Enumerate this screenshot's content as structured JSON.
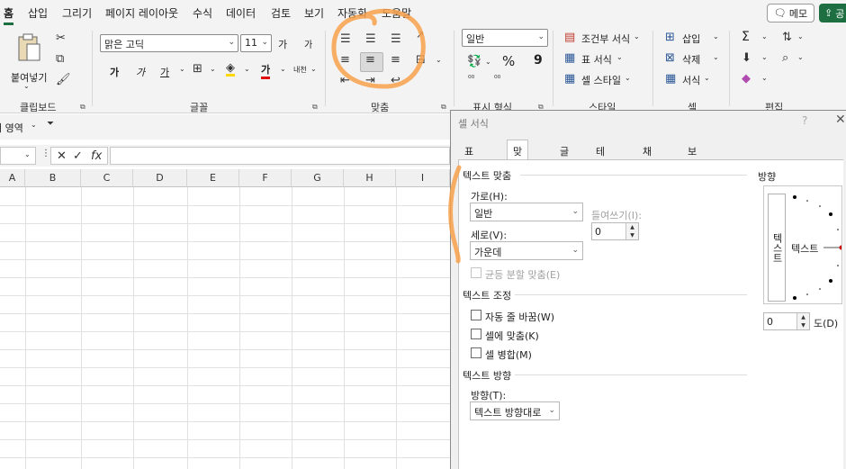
{
  "menubar": {
    "tabs": [
      "홈",
      "삽입",
      "그리기",
      "페이지 레이아웃",
      "수식",
      "데이터",
      "검토",
      "보기",
      "자동화",
      "도움말"
    ],
    "memo_label": "메모",
    "share_label": "공"
  },
  "ribbon": {
    "clipboard": {
      "paste_label": "붙여넣기",
      "group_label": "클립보드"
    },
    "font": {
      "font_name": "맑은 고딕",
      "font_size": "11",
      "bold": "가",
      "italic": "가",
      "underline": "가",
      "font_color_glyph": "가",
      "grow": "가",
      "shrink": "가",
      "phonetic": "내천",
      "group_label": "글꼴"
    },
    "alignment": {
      "group_label": "맞춤"
    },
    "number": {
      "format": "일반",
      "percent": "%",
      "comma": "9",
      "group_label": "표시 형식"
    },
    "styles": {
      "conditional": "조건부 서식",
      "table": "표 서식",
      "cell_style": "셀 스타일",
      "group_label": "스타일"
    },
    "cells": {
      "insert": "삽입",
      "delete": "삭제",
      "format": "서식",
      "group_label": "셀"
    },
    "editing": {
      "sum": "Σ",
      "group_label": "편집"
    }
  },
  "qa": {
    "area_label": "내 영역"
  },
  "grid": {
    "columns": [
      "A",
      "B",
      "C",
      "D",
      "E",
      "F",
      "G",
      "H",
      "I"
    ]
  },
  "dialog": {
    "title": "셀 서식",
    "help": "?",
    "close": "✕",
    "tabs": [
      "표시 형식",
      "맞춤",
      "글꼴",
      "테두리",
      "채우기",
      "보호"
    ],
    "active_tab": "맞춤",
    "text_align_section": "텍스트 맞춤",
    "horizontal_label": "가로(H):",
    "horizontal_value": "일반",
    "vertical_label": "세로(V):",
    "vertical_value": "가운데",
    "indent_label": "들여쓰기(I):",
    "indent_value": "0",
    "justify_distributed": "균등 분할 맞춤(E)",
    "text_control_section": "텍스트 조정",
    "wrap_text": "자동 줄 바꿈(W)",
    "shrink_to_fit": "셀에 맞춤(K)",
    "merge_cells": "셀 병합(M)",
    "rtl_section": "텍스트 방향",
    "direction_label": "방향(T):",
    "direction_value": "텍스트 방향대로",
    "orientation_section": "방향",
    "vertical_text": "텍스트",
    "dial_text": "텍스트",
    "degrees_value": "0",
    "degrees_label": "도(D)"
  }
}
